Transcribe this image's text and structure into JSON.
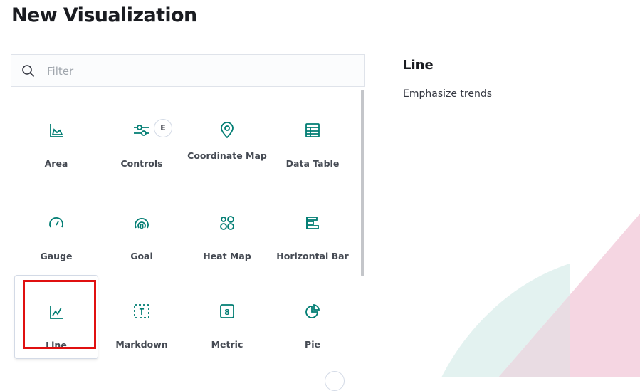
{
  "page": {
    "title": "New Visualization"
  },
  "search": {
    "placeholder": "Filter"
  },
  "types": [
    {
      "label": "Area",
      "icon": "area-chart-icon"
    },
    {
      "label": "Controls",
      "icon": "controls-icon",
      "badge": "E"
    },
    {
      "label": "Coordinate Map",
      "icon": "map-pin-icon"
    },
    {
      "label": "Data Table",
      "icon": "data-table-icon"
    },
    {
      "label": "Gauge",
      "icon": "gauge-icon"
    },
    {
      "label": "Goal",
      "icon": "goal-icon"
    },
    {
      "label": "Heat Map",
      "icon": "heat-map-icon"
    },
    {
      "label": "Horizontal Bar",
      "icon": "horizontal-bar-icon"
    },
    {
      "label": "Line",
      "icon": "line-chart-icon"
    },
    {
      "label": "Markdown",
      "icon": "markdown-icon"
    },
    {
      "label": "Metric",
      "icon": "metric-icon"
    },
    {
      "label": "Pie",
      "icon": "pie-chart-icon"
    }
  ],
  "selected": "Line",
  "detail": {
    "title": "Line",
    "description": "Emphasize trends"
  },
  "colors": {
    "accent": "#017d73",
    "highlight": "#e01010",
    "bg_teal": "#e3f2f0",
    "bg_pink": "#f5d6e2"
  }
}
